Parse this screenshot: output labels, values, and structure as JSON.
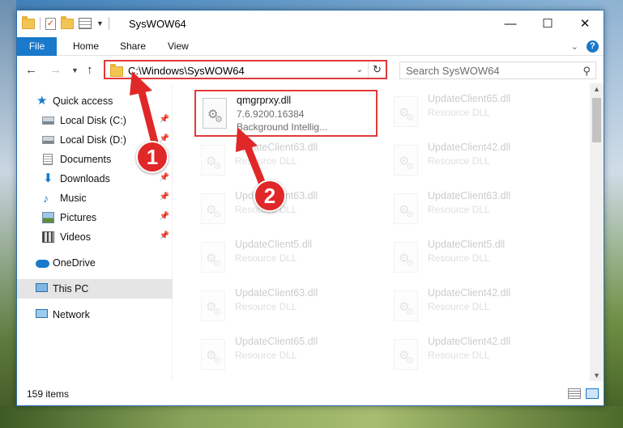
{
  "window": {
    "title": "SysWOW64",
    "controls": {
      "minimize": "—",
      "maximize": "☐",
      "close": "✕"
    }
  },
  "ribbon": {
    "tabs": [
      "File",
      "Home",
      "Share",
      "View"
    ]
  },
  "navigation": {
    "address": "C:\\Windows\\SysWOW64",
    "search_placeholder": "Search SysWOW64"
  },
  "sidebar": {
    "items": [
      {
        "label": "Quick access",
        "icon": "star-icon",
        "pinned": false
      },
      {
        "label": "Local Disk (C:)",
        "icon": "drive-icon",
        "pinned": true
      },
      {
        "label": "Local Disk (D:)",
        "icon": "drive-icon",
        "pinned": true
      },
      {
        "label": "Documents",
        "icon": "documents-icon",
        "pinned": true
      },
      {
        "label": "Downloads",
        "icon": "downloads-icon",
        "pinned": true
      },
      {
        "label": "Music",
        "icon": "music-icon",
        "pinned": true
      },
      {
        "label": "Pictures",
        "icon": "pictures-icon",
        "pinned": true
      },
      {
        "label": "Videos",
        "icon": "videos-icon",
        "pinned": true
      },
      {
        "label": "OneDrive",
        "icon": "onedrive-icon",
        "pinned": false
      },
      {
        "label": "This PC",
        "icon": "this-pc-icon",
        "pinned": false,
        "selected": true
      },
      {
        "label": "Network",
        "icon": "network-icon",
        "pinned": false
      }
    ]
  },
  "files": [
    {
      "name": "qmgrprxy.dll",
      "line2": "7.6.9200.16384",
      "line3": "Background Intellig...",
      "highlighted": true
    },
    {
      "name": "UpdateClient65.dll",
      "line2": "Resource DLL"
    },
    {
      "name": "UpdateClient63.dll",
      "line2": "Resource DLL"
    },
    {
      "name": "UpdateClient42.dll",
      "line2": "Resource DLL"
    },
    {
      "name": "UpdateClient63.dll",
      "line2": "Resource DLL"
    },
    {
      "name": "UpdateClient63.dll",
      "line2": "Resource DLL"
    },
    {
      "name": "UpdateClient5.dll",
      "line2": "Resource DLL"
    },
    {
      "name": "UpdateClient5.dll",
      "line2": "Resource DLL"
    },
    {
      "name": "UpdateClient63.dll",
      "line2": "Resource DLL"
    },
    {
      "name": "UpdateClient42.dll",
      "line2": "Resource DLL"
    },
    {
      "name": "UpdateClient65.dll",
      "line2": "Resource DLL"
    },
    {
      "name": "UpdateClient42.dll",
      "line2": "Resource DLL"
    }
  ],
  "status": {
    "item_count": "159 items"
  },
  "annotations": {
    "step1": "1",
    "step2": "2",
    "color": "#e02828"
  }
}
